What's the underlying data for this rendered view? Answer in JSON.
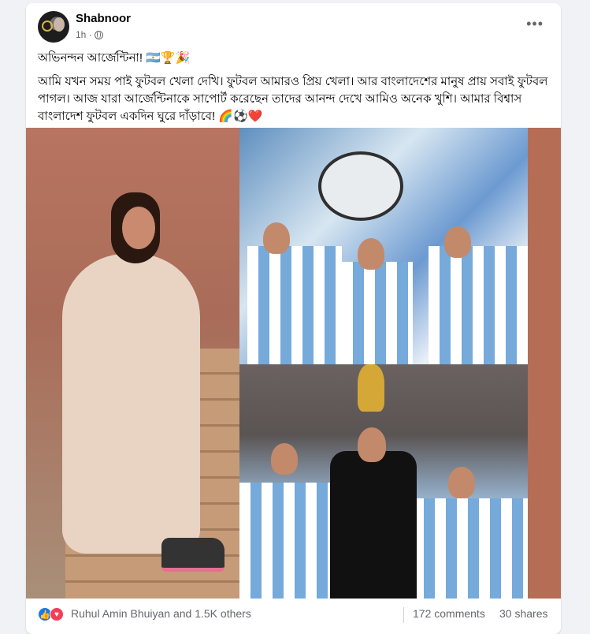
{
  "post": {
    "author": "Shabnoor",
    "time": "1h ·",
    "more_label": "•••",
    "headline": "অভিনন্দন আর্জেন্টিনা! 🇦🇷🏆🎉",
    "body": "আমি যখন সময় পাই ফুটবল খেলা দেখি। ফুটবল আমারও প্রিয় খেলা। আর বাংলাদেশের মানুষ প্রায় সবাই ফুটবল পাগল। আজ যারা আর্জেন্টিনাকে সাপোর্ট করেছেন তাদের আনন্দ দেখে আমিও অনেক খুশি। আমার বিশ্বাস বাংলাদেশ ফুটবল একদিন ঘুরে দাঁড়াবে! 🌈⚽❤️"
  },
  "reactions": {
    "icons": [
      "like-icon",
      "love-icon"
    ],
    "text": "Ruhul Amin Bhuiyan and 1.5K others",
    "comments": "172 comments",
    "shares": "30 shares"
  },
  "colors": {
    "accent": "#1877f2",
    "love": "#f33e58",
    "photo_bg": "#b56d55"
  }
}
